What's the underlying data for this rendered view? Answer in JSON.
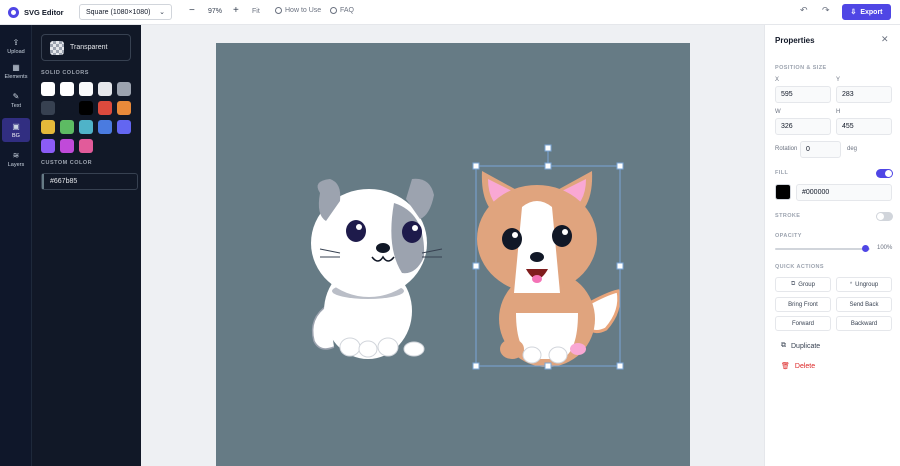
{
  "app": {
    "title": "SVG Editor"
  },
  "toolbar": {
    "size_preset": "Square (1080×1080)",
    "zoom": "97%",
    "zoom_out": "−",
    "zoom_in": "+",
    "fit": "Fit",
    "how_to_use": "How to Use",
    "faq": "FAQ",
    "undo": "↶",
    "redo": "↷",
    "export": "Export"
  },
  "rail": [
    {
      "label": "Upload",
      "icon": "upload-icon",
      "glyph": "⇪"
    },
    {
      "label": "Elements",
      "icon": "elements-icon",
      "glyph": "▦"
    },
    {
      "label": "Text",
      "icon": "text-icon",
      "glyph": "✎"
    },
    {
      "label": "BG",
      "icon": "background-icon",
      "glyph": "▣",
      "active": true
    },
    {
      "label": "Layers",
      "icon": "layers-icon",
      "glyph": "≋"
    }
  ],
  "bg_panel": {
    "transparent_label": "Transparent",
    "solid_colors_label": "SOLID COLORS",
    "solid_colors": [
      "#ffffff",
      "#ffffff",
      "#f9fafb",
      "#e5e7eb",
      "#9ca3af",
      "#374151",
      "#111827",
      "#000000",
      "#dc4a3d",
      "#e88a3a",
      "#e5b93a",
      "#5dbb63",
      "#4fb3c8",
      "#4a7be0",
      "#6366f1",
      "#8b5cf6",
      "#c04ad9",
      "#e25b9a"
    ],
    "custom_color_label": "CUSTOM COLOR",
    "custom_color_value": "#667b85"
  },
  "canvas": {
    "background": "#667b85"
  },
  "properties": {
    "title": "Properties",
    "position_size_label": "POSITION & SIZE",
    "x_label": "X",
    "x_value": "595",
    "y_label": "Y",
    "y_value": "283",
    "w_label": "W",
    "w_value": "326",
    "h_label": "H",
    "h_value": "455",
    "rotation_label": "Rotation",
    "rotation_value": "0",
    "rotation_unit": "deg",
    "fill_label": "FILL",
    "fill_enabled": true,
    "fill_value": "#000000",
    "stroke_label": "STROKE",
    "stroke_enabled": false,
    "opacity_label": "OPACITY",
    "opacity_value": "100%",
    "opacity_fraction": 1.0,
    "quick_actions_label": "QUICK ACTIONS",
    "quick_actions": {
      "group": "Group",
      "ungroup": "Ungroup",
      "bring_front": "Bring Front",
      "send_back": "Send Back",
      "forward": "Forward",
      "backward": "Backward"
    },
    "duplicate": "Duplicate",
    "delete": "Delete"
  },
  "colors": {
    "accent": "#4f46e5",
    "rail_bg": "#0f172a",
    "panel_bg": "#111827",
    "danger": "#dc2626",
    "selection": "#7aa6d6"
  }
}
